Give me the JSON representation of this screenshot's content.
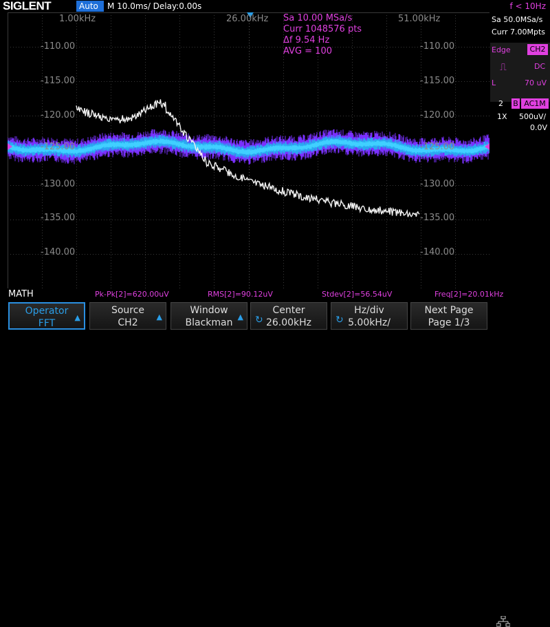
{
  "topbar": {
    "logo": "SIGLENT",
    "mode": "Auto",
    "timebase": "M 10.0ms/ Delay:0.00s",
    "trigger_freq": "f < 10Hz"
  },
  "fft_info": {
    "freq_left": "1.00kHz",
    "freq_center": "26.00kHz",
    "freq_right": "51.00kHz",
    "sample_rate": "Sa 10.00 MSa/s",
    "curr_pts": "Curr 1048576 pts",
    "delta_f": "Δf 9.54 Hz",
    "avg": "AVG = 100"
  },
  "y_labels": [
    "-110.00",
    "-115.00",
    "-120.00",
    "-125.00",
    "-130.00",
    "-135.00",
    "-140.00"
  ],
  "right_panel": {
    "sa": "Sa 50.0MSa/s",
    "curr": "Curr 7.00Mpts",
    "edge_label": "Edge",
    "edge_ch": "CH2",
    "coupling": "DC",
    "level_label": "L",
    "level": "70 uV",
    "ch_num": "2",
    "bw": "B",
    "ch_coupling": "AC1M",
    "probe": "1X",
    "vdiv": "500uV/",
    "offset": "0.0V"
  },
  "math_bar": {
    "label": "MATH",
    "pkpk": "Pk-Pk[2]=620.00uV",
    "rms": "RMS[2]=90.12uV",
    "stdev": "Stdev[2]=56.54uV",
    "freq": "Freq[2]=20.01kHz"
  },
  "softkeys": [
    {
      "l1": "Operator",
      "l2": "FFT"
    },
    {
      "l1": "Source",
      "l2": "CH2"
    },
    {
      "l1": "Window",
      "l2": "Blackman"
    },
    {
      "l1": "Center",
      "l2": "26.00kHz"
    },
    {
      "l1": "Hz/div",
      "l2": "5.00kHz/"
    },
    {
      "l1": "Next Page",
      "l2": "Page 1/3"
    }
  ],
  "colors": {
    "accent": "#e040e0",
    "blue": "#2a8fe0",
    "ch2_trace": "#7a30ff",
    "ch2_core": "#40d0ff",
    "fft_trace": "#f0f0f0"
  }
}
